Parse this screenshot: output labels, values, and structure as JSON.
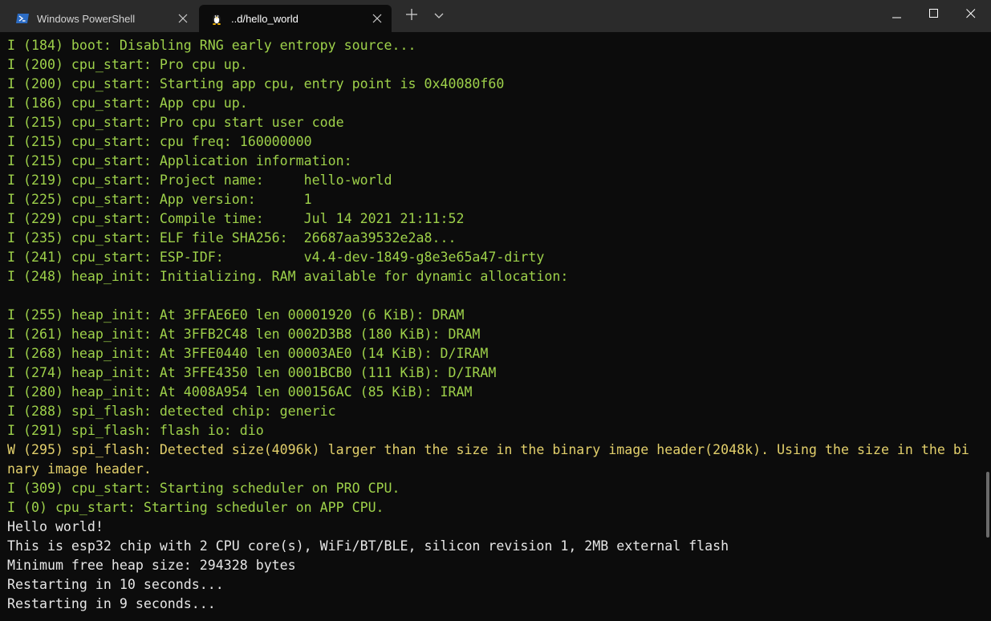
{
  "tabs": [
    {
      "label": "Windows PowerShell",
      "icon": "powershell-icon",
      "active": false
    },
    {
      "label": "..d/hello_world",
      "icon": "linux-penguin-icon",
      "active": true
    }
  ],
  "terminal": {
    "lines": [
      {
        "text": "I (184) boot: Disabling RNG early entropy source...",
        "level": "info"
      },
      {
        "text": "I (200) cpu_start: Pro cpu up.",
        "level": "info"
      },
      {
        "text": "I (200) cpu_start: Starting app cpu, entry point is 0x40080f60",
        "level": "info"
      },
      {
        "text": "I (186) cpu_start: App cpu up.",
        "level": "info"
      },
      {
        "text": "I (215) cpu_start: Pro cpu start user code",
        "level": "info"
      },
      {
        "text": "I (215) cpu_start: cpu freq: 160000000",
        "level": "info"
      },
      {
        "text": "I (215) cpu_start: Application information:",
        "level": "info"
      },
      {
        "text": "I (219) cpu_start: Project name:     hello-world",
        "level": "info"
      },
      {
        "text": "I (225) cpu_start: App version:      1",
        "level": "info"
      },
      {
        "text": "I (229) cpu_start: Compile time:     Jul 14 2021 21:11:52",
        "level": "info"
      },
      {
        "text": "I (235) cpu_start: ELF file SHA256:  26687aa39532e2a8...",
        "level": "info"
      },
      {
        "text": "I (241) cpu_start: ESP-IDF:          v4.4-dev-1849-g8e3e65a47-dirty",
        "level": "info"
      },
      {
        "text": "I (248) heap_init: Initializing. RAM available for dynamic allocation:",
        "level": "info"
      },
      {
        "text": "",
        "level": "plain"
      },
      {
        "text": "I (255) heap_init: At 3FFAE6E0 len 00001920 (6 KiB): DRAM",
        "level": "info"
      },
      {
        "text": "I (261) heap_init: At 3FFB2C48 len 0002D3B8 (180 KiB): DRAM",
        "level": "info"
      },
      {
        "text": "I (268) heap_init: At 3FFE0440 len 00003AE0 (14 KiB): D/IRAM",
        "level": "info"
      },
      {
        "text": "I (274) heap_init: At 3FFE4350 len 0001BCB0 (111 KiB): D/IRAM",
        "level": "info"
      },
      {
        "text": "I (280) heap_init: At 4008A954 len 000156AC (85 KiB): IRAM",
        "level": "info"
      },
      {
        "text": "I (288) spi_flash: detected chip: generic",
        "level": "info"
      },
      {
        "text": "I (291) spi_flash: flash io: dio",
        "level": "info"
      },
      {
        "text": "W (295) spi_flash: Detected size(4096k) larger than the size in the binary image header(2048k). Using the size in the bi",
        "level": "warn"
      },
      {
        "text": "nary image header.",
        "level": "warn"
      },
      {
        "text": "I (309) cpu_start: Starting scheduler on PRO CPU.",
        "level": "info"
      },
      {
        "text": "I (0) cpu_start: Starting scheduler on APP CPU.",
        "level": "info"
      },
      {
        "text": "Hello world!",
        "level": "plain"
      },
      {
        "text": "This is esp32 chip with 2 CPU core(s), WiFi/BT/BLE, silicon revision 1, 2MB external flash",
        "level": "plain"
      },
      {
        "text": "Minimum free heap size: 294328 bytes",
        "level": "plain"
      },
      {
        "text": "Restarting in 10 seconds...",
        "level": "plain"
      },
      {
        "text": "Restarting in 9 seconds...",
        "level": "plain"
      }
    ]
  },
  "icons": {
    "new_tab": "plus-icon",
    "dropdown": "chevron-down-icon",
    "minimize": "minimize-icon",
    "maximize": "maximize-icon",
    "close": "close-icon"
  },
  "colors": {
    "info": "#9ed14a",
    "warn": "#e2cf6b",
    "plain": "#e6e6e6",
    "background": "#0c0c0c",
    "titlebar": "#2b2b2b"
  }
}
